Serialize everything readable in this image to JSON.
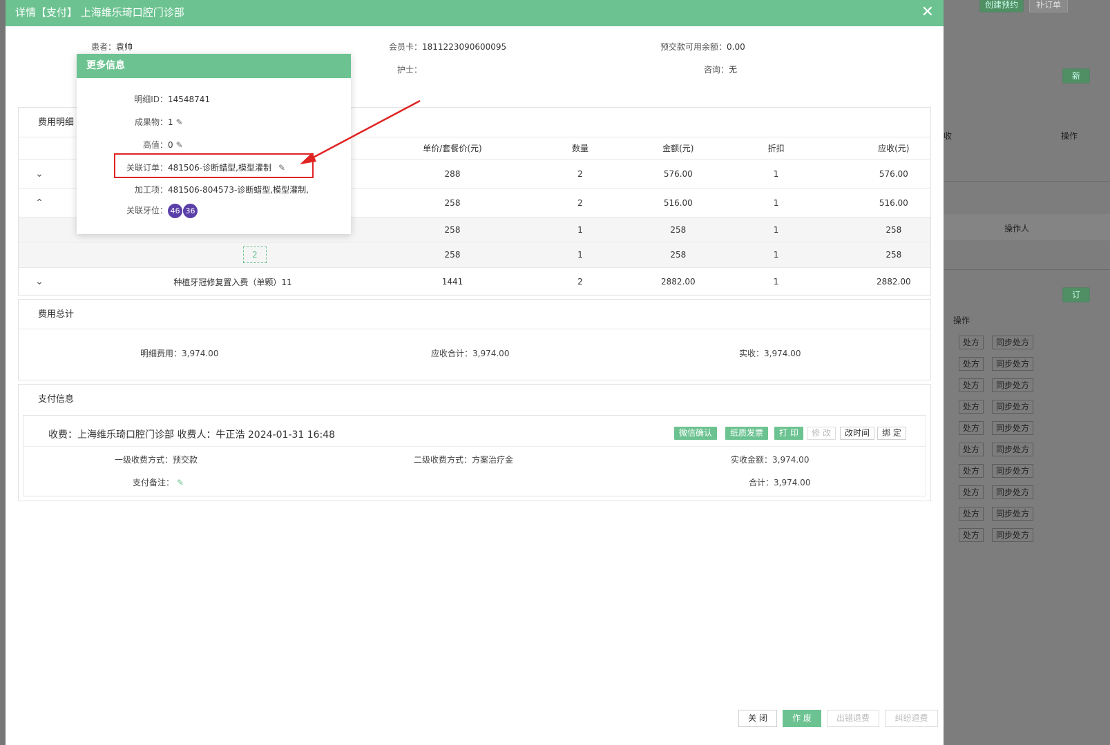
{
  "background": {
    "top_buttons": [
      "创建预约",
      "补订单"
    ],
    "side_fragments": [
      "新",
      "订"
    ],
    "column_headers": [
      "收",
      "操作",
      "操作人",
      "操作"
    ],
    "row_actions": [
      "处方",
      "同步处方"
    ]
  },
  "modal": {
    "title": "详情【支付】 上海维乐琦口腔门诊部",
    "info": {
      "patient_label": "患者：",
      "patient_value": "袁帅",
      "member_card_label": "会员卡：",
      "member_card_value": "1811223090600095",
      "prepay_label": "预交款可用余额：",
      "prepay_value": "0.00",
      "nurse_label": "护士：",
      "nurse_value": "",
      "consult_label": "咨询：",
      "consult_value": "无"
    },
    "fee_detail": {
      "title": "费用明细",
      "headers": [
        "单价/套餐价(元)",
        "数量",
        "金额(元)",
        "折扣",
        "应收(元)"
      ],
      "rows": [
        {
          "name": "",
          "price": "288",
          "qty": "2",
          "amount": "576.00",
          "discount": "1",
          "receivable": "576.00"
        },
        {
          "name": "",
          "price": "258",
          "qty": "2",
          "amount": "516.00",
          "discount": "1",
          "receivable": "516.00"
        },
        {
          "name": "",
          "price": "258",
          "qty": "1",
          "amount": "258",
          "discount": "1",
          "receivable": "258"
        },
        {
          "name": "2",
          "price": "258",
          "qty": "1",
          "amount": "258",
          "discount": "1",
          "receivable": "258"
        },
        {
          "name": "种植牙冠修复置入费（单颗）11",
          "price": "1441",
          "qty": "2",
          "amount": "2882.00",
          "discount": "1",
          "receivable": "2882.00"
        }
      ]
    },
    "fee_total": {
      "title": "费用总计",
      "detail_label": "明细费用：",
      "detail_value": "3,974.00",
      "receivable_label": "应收合计：",
      "receivable_value": "3,974.00",
      "actual_label": "实收：",
      "actual_value": "3,974.00"
    },
    "payment": {
      "title": "支付信息",
      "header_text": "收费：上海维乐琦口腔门诊部   收费人：牛正浩   2024-01-31 16:48",
      "buttons": {
        "wechat": "微信确认",
        "paper_invoice": "纸质发票",
        "print": "打 印",
        "modify": "修 改",
        "change_time": "改时间",
        "bind": "绑 定"
      },
      "level1_label": "一级收费方式：",
      "level1_value": "预交款",
      "level2_label": "二级收费方式：",
      "level2_value": "方案治疗金",
      "actual_amount_label": "实收金额：",
      "actual_amount_value": "3,974.00",
      "remark_label": "支付备注：",
      "total_label": "合计：",
      "total_value": "3,974.00"
    },
    "footer": {
      "close": "关 闭",
      "void": "作 废",
      "refund_error": "出错退费",
      "refund_dispute": "纠纷退费"
    }
  },
  "popover": {
    "title": "更多信息",
    "detail_id_label": "明细ID：",
    "detail_id_value": "14548741",
    "result_label": "成果物：",
    "result_value": "1",
    "high_value_label": "高值：",
    "high_value_value": "0",
    "linked_order_label": "关联订单：",
    "linked_order_value": "481506-诊断蜡型,模型灌制",
    "process_label": "加工项：",
    "process_value": "481506-804573-诊断蜡型,模型灌制,",
    "teeth_label": "关联牙位：",
    "teeth": [
      "46",
      "36"
    ]
  },
  "colors": {
    "primary": "#6cc391",
    "highlight_border": "#e02424",
    "tooth_badge": "#5b3fa8"
  }
}
